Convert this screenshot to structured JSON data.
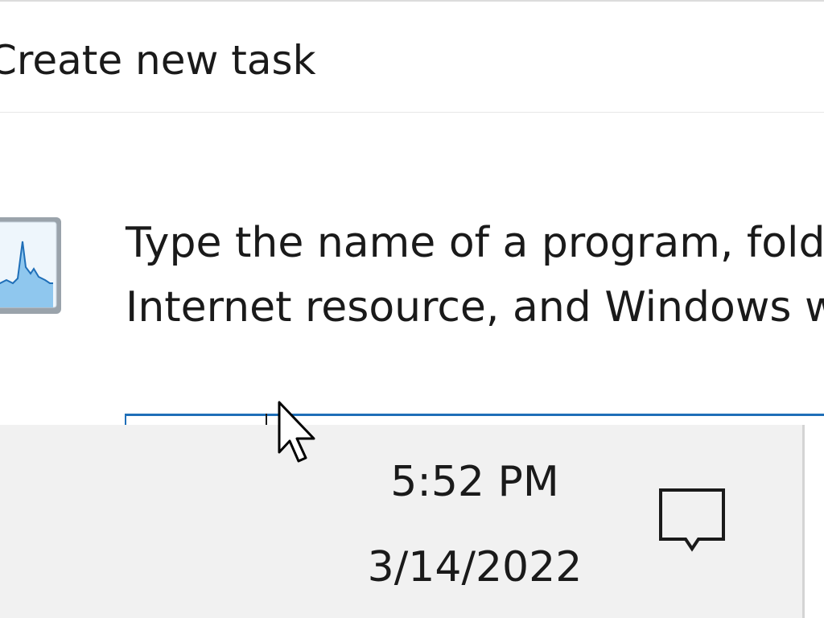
{
  "dialog": {
    "title": "Create new task",
    "prompt_line1": "Type the name of a program, folder, document, or",
    "prompt_line2": "Internet resource, and Windows will open it for you.",
    "open_input_value": ""
  },
  "taskbar": {
    "time": "5:52 PM",
    "date": "3/14/2022"
  },
  "icons": {
    "app_icon": "task-manager-icon",
    "notification_icon": "action-center-icon",
    "cursor": "mouse-pointer-icon"
  },
  "colors": {
    "input_border_focus": "#1f6fb8",
    "taskbar_bg": "#f1f1f1",
    "text": "#1a1a1a"
  }
}
